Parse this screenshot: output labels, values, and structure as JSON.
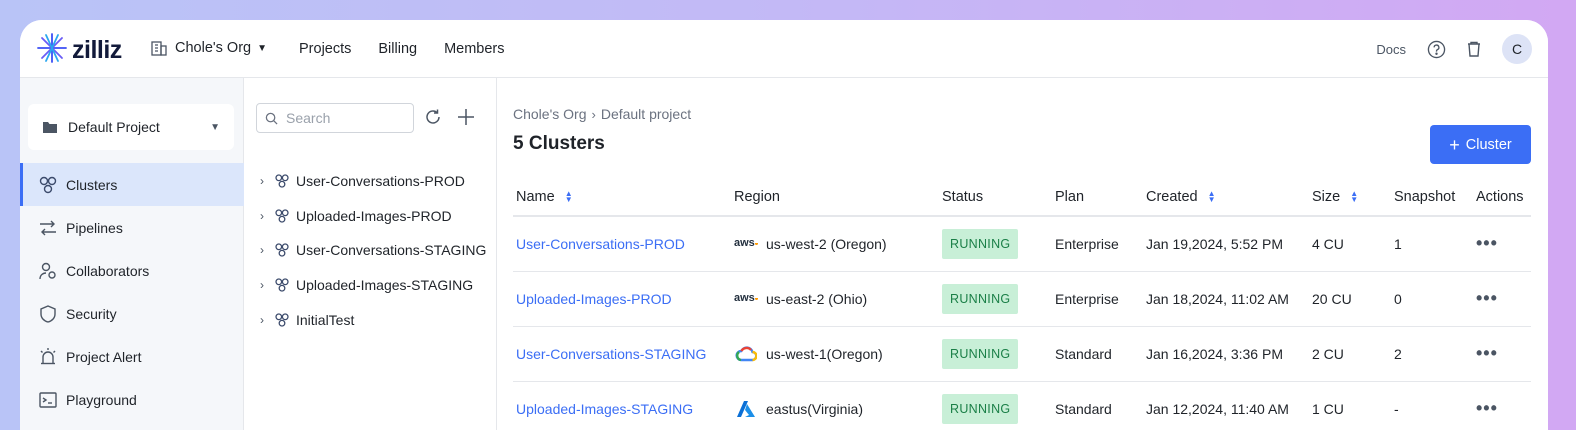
{
  "app": {
    "logo_text": "zilliz"
  },
  "topbar": {
    "org_name": "Chole's Org",
    "nav": [
      "Projects",
      "Billing",
      "Members"
    ],
    "docs_label": "Docs",
    "avatar_initial": "C"
  },
  "sidebar": {
    "project_selector": "Default Project",
    "items": [
      {
        "label": "Clusters",
        "icon": "clusters-icon",
        "active": true
      },
      {
        "label": "Pipelines",
        "icon": "pipelines-icon"
      },
      {
        "label": "Collaborators",
        "icon": "collaborators-icon"
      },
      {
        "label": "Security",
        "icon": "shield-icon"
      },
      {
        "label": "Project Alert",
        "icon": "alarm-icon"
      },
      {
        "label": "Playground",
        "icon": "terminal-icon"
      }
    ]
  },
  "tree": {
    "search_placeholder": "Search",
    "items": [
      "User-Conversations-PROD",
      "Uploaded-Images-PROD",
      "User-Conversations-STAGING",
      "Uploaded-Images-STAGING",
      "InitialTest"
    ]
  },
  "main": {
    "breadcrumb": [
      "Chole's Org",
      "Default project"
    ],
    "title": "5 Clusters",
    "add_button": "Cluster",
    "columns": [
      "Name",
      "Region",
      "Status",
      "Plan",
      "Created",
      "Size",
      "Snapshot",
      "Actions"
    ],
    "rows": [
      {
        "name": "User-Conversations-PROD",
        "provider": "aws",
        "region": "us-west-2 (Oregon)",
        "status": "RUNNING",
        "plan": "Enterprise",
        "created": "Jan 19,2024, 5:52 PM",
        "size": "4 CU",
        "snapshot": "1"
      },
      {
        "name": "Uploaded-Images-PROD",
        "provider": "aws",
        "region": "us-east-2 (Ohio)",
        "status": "RUNNING",
        "plan": "Enterprise",
        "created": "Jan 18,2024, 11:02 AM",
        "size": "20 CU",
        "snapshot": "0"
      },
      {
        "name": "User-Conversations-STAGING",
        "provider": "gcp",
        "region": "us-west-1(Oregon)",
        "status": "RUNNING",
        "plan": "Standard",
        "created": "Jan 16,2024, 3:36 PM",
        "size": "2 CU",
        "snapshot": "2"
      },
      {
        "name": "Uploaded-Images-STAGING",
        "provider": "azure",
        "region": "eastus(Virginia)",
        "status": "RUNNING",
        "plan": "Standard",
        "created": "Jan 12,2024, 11:40 AM",
        "size": "1 CU",
        "snapshot": "-"
      }
    ]
  },
  "colors": {
    "accent": "#3b6ef5",
    "status_bg": "#c8efd7",
    "status_text": "#1a7f47",
    "sidebar_bg": "#f5f7fa"
  }
}
